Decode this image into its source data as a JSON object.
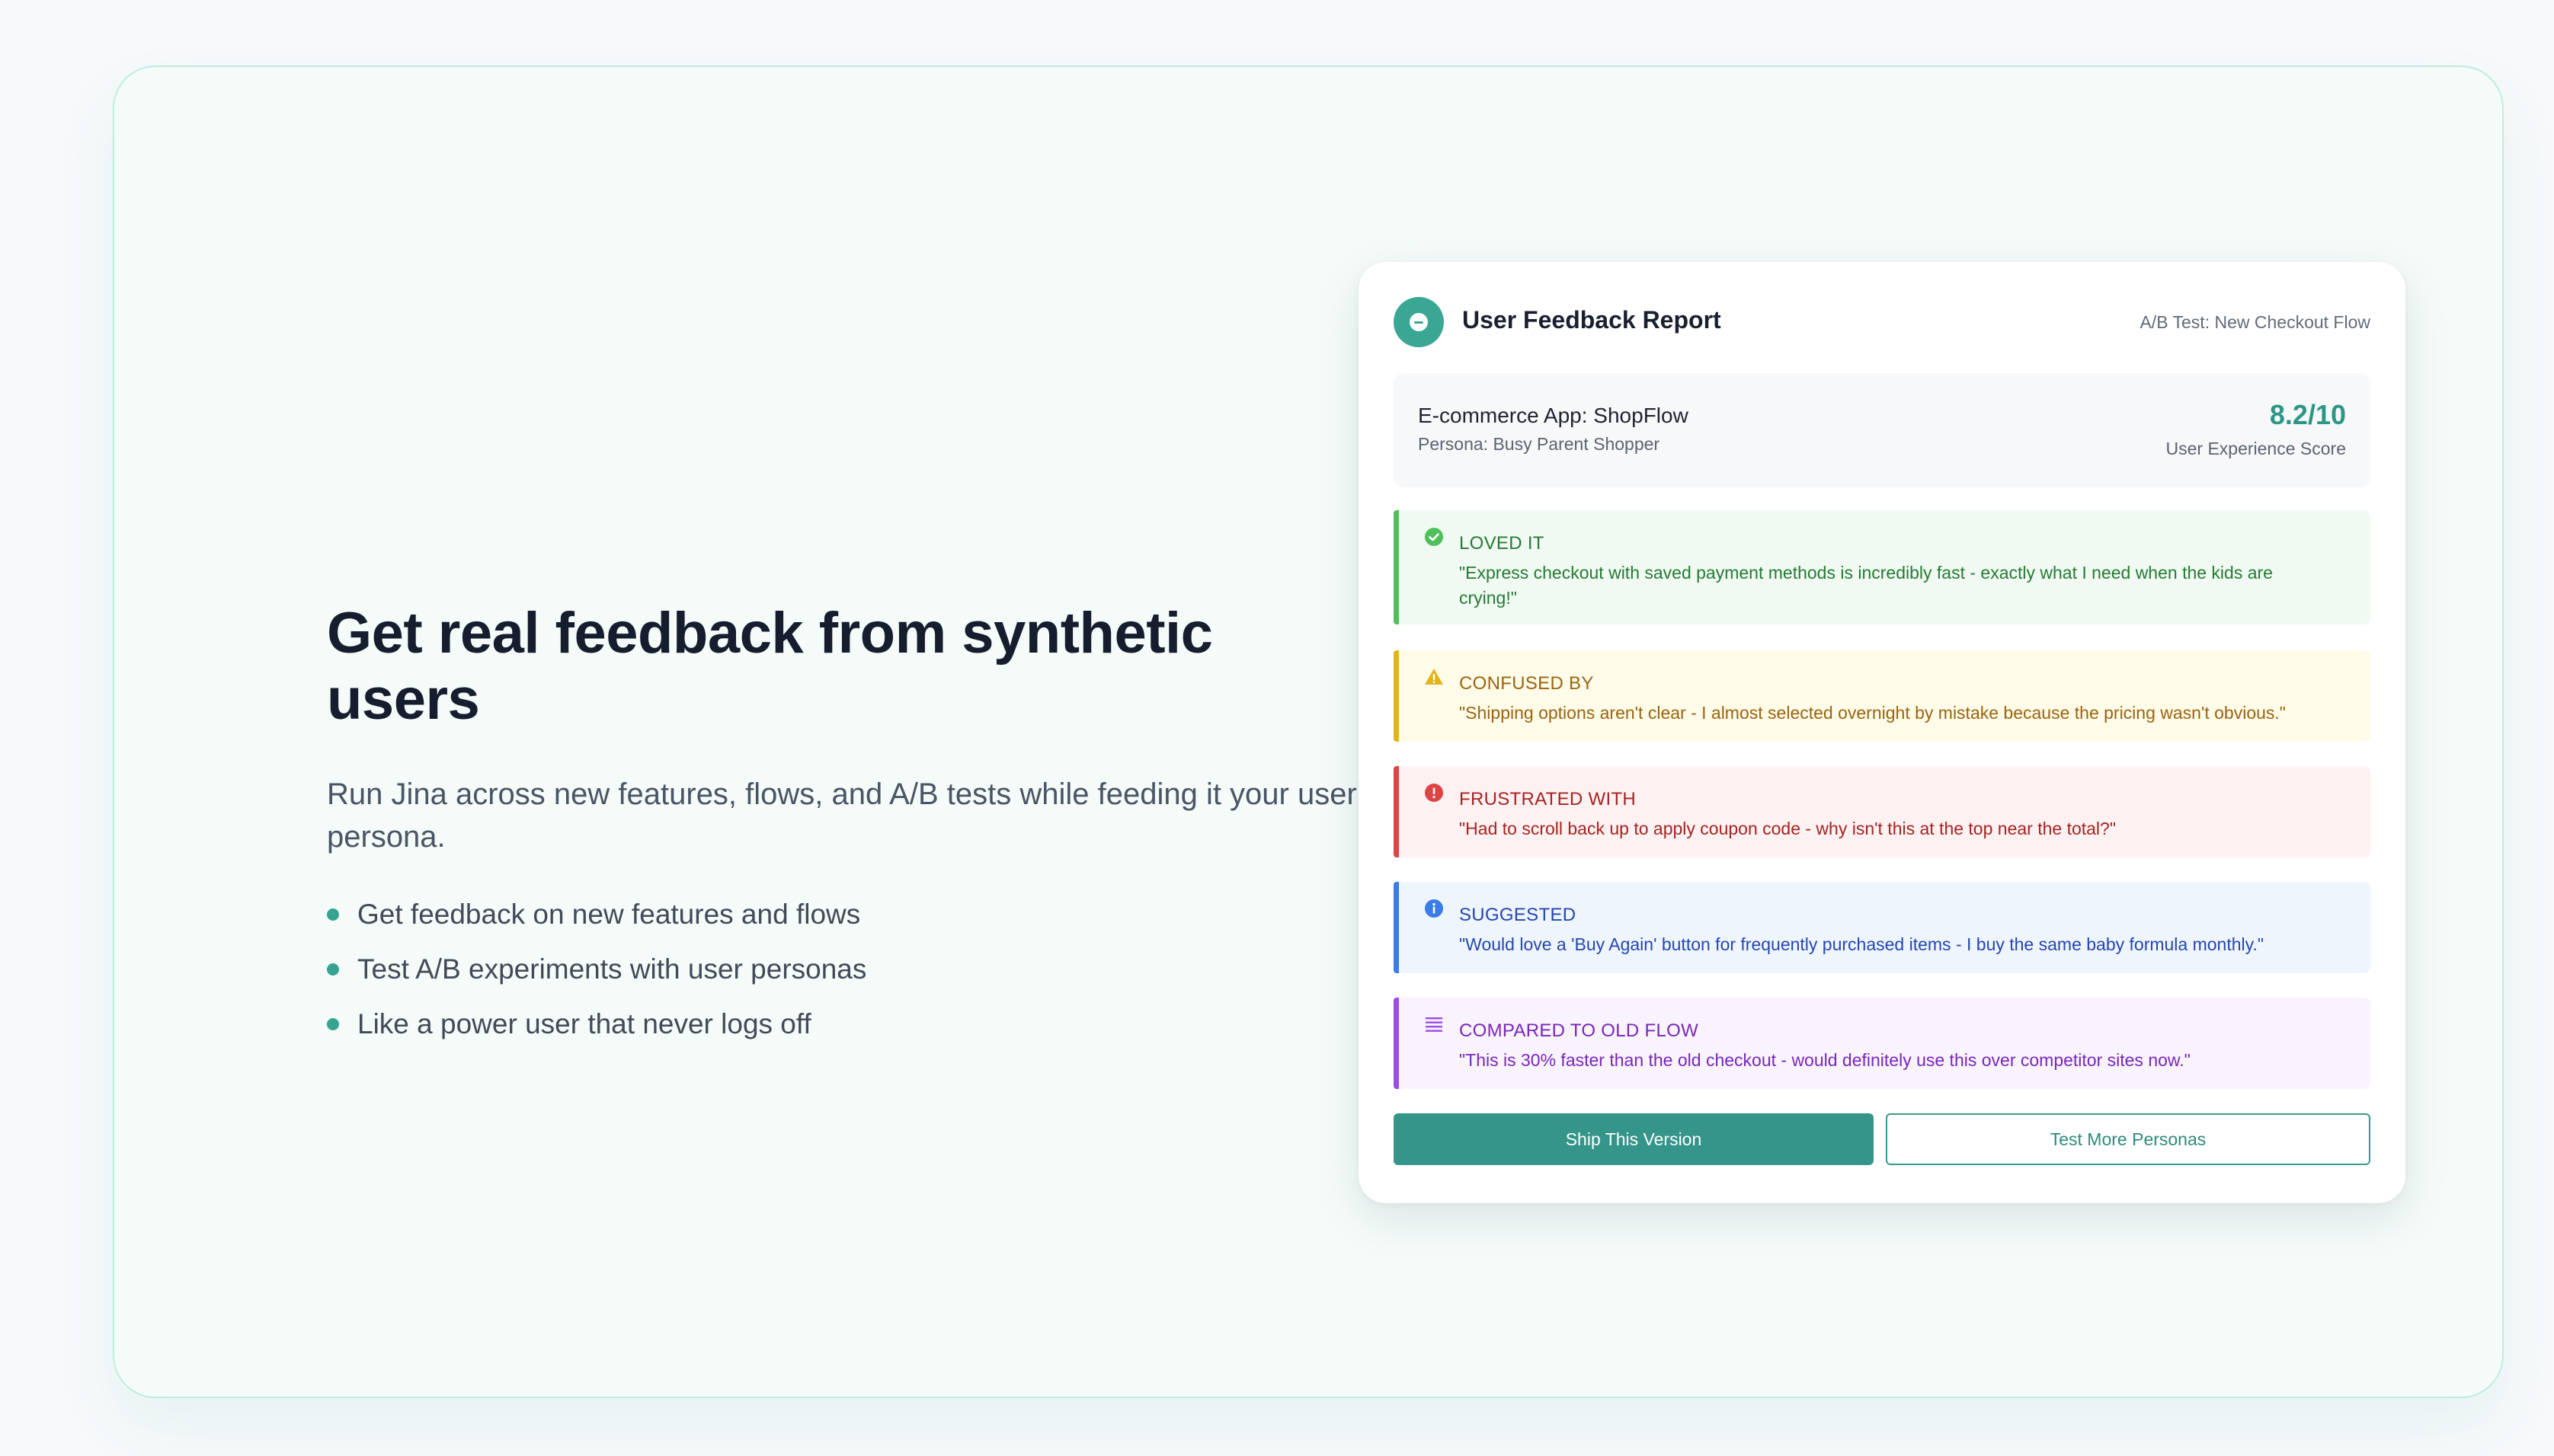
{
  "hero": {
    "headline": "Get real feedback from synthetic users",
    "subheadline": "Run Jina across new features, flows, and A/B tests while feeding it your user's persona.",
    "bullets": [
      "Get feedback on new features and flows",
      "Test A/B experiments with user personas",
      "Like a power user that never logs off"
    ]
  },
  "report": {
    "icon": "chat-bubble-icon",
    "title": "User Feedback Report",
    "test_label": "A/B Test: New Checkout Flow",
    "app_name": "E-commerce App: ShopFlow",
    "persona": "Persona: Busy Parent Shopper",
    "score": "8.2/10",
    "score_label": "User Experience Score",
    "feedback": [
      {
        "label": "LOVED IT",
        "icon": "check-circle-icon",
        "color": "#4fbf5c",
        "quote": "\"Express checkout with saved payment methods is incredibly fast - exactly what I need when the kids are crying!\""
      },
      {
        "label": "CONFUSED BY",
        "icon": "warning-triangle-icon",
        "color": "#e3b31a",
        "quote": "\"Shipping options aren't clear - I almost selected overnight by mistake because the pricing wasn't obvious.\""
      },
      {
        "label": "FRUSTRATED WITH",
        "icon": "alert-circle-icon",
        "color": "#dd4545",
        "quote": "\"Had to scroll back up to apply coupon code - why isn't this at the top near the total?\""
      },
      {
        "label": "SUGGESTED",
        "icon": "info-circle-icon",
        "color": "#3b7de6",
        "quote": "\"Would love a 'Buy Again' button for frequently purchased items - I buy the same baby formula monthly.\""
      },
      {
        "label": "COMPARED TO OLD FLOW",
        "icon": "list-icon",
        "color": "#9a4ee8",
        "quote": "\"This is 30% faster than the old checkout - would definitely use this over competitor sites now.\""
      }
    ],
    "buttons": {
      "ship": "Ship This Version",
      "test_more": "Test More Personas"
    }
  }
}
